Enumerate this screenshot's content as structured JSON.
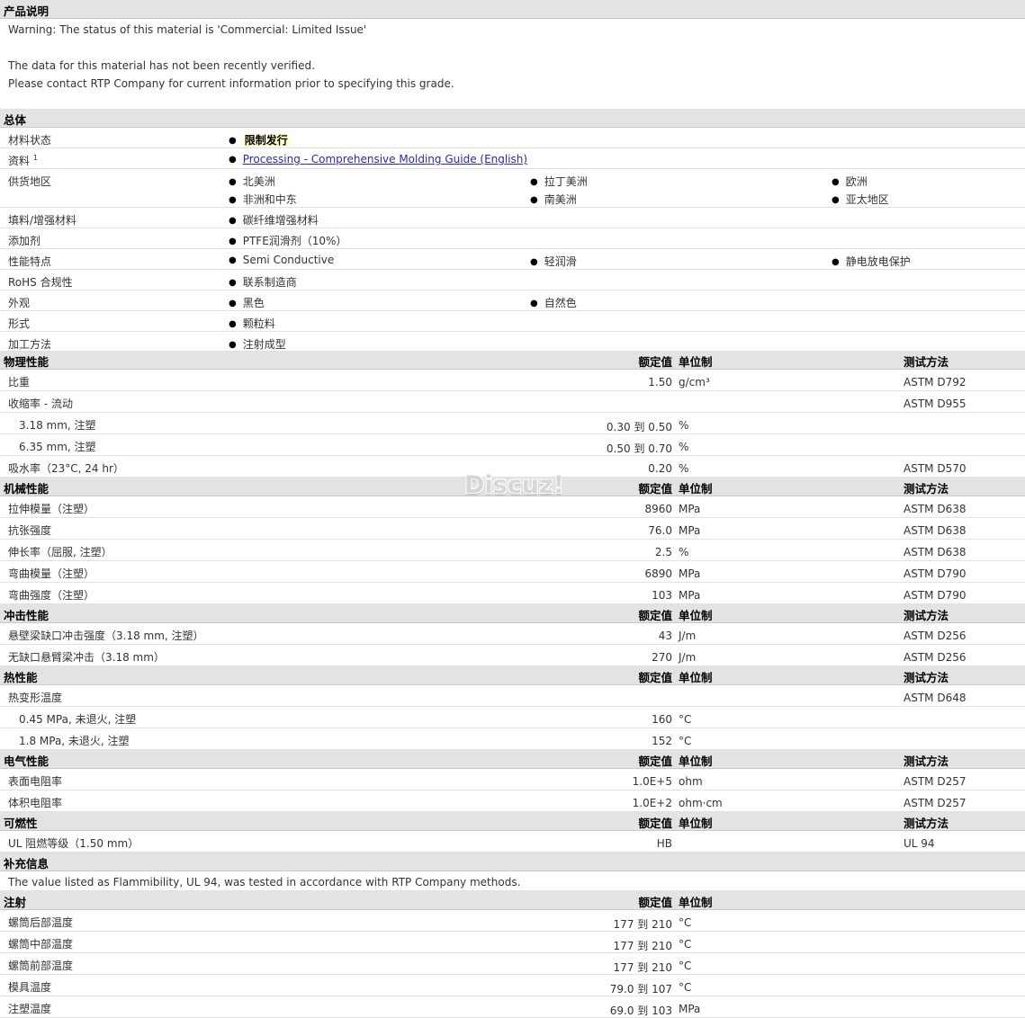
{
  "product_description": {
    "title": "产品说明",
    "lines": [
      "Warning: The status of this material is 'Commercial: Limited Issue'",
      "The data for this material has not been recently verified.",
      "Please contact RTP Company for current information prior to specifying this grade."
    ]
  },
  "general": {
    "title": "总体",
    "material_status": {
      "label": "材料状态",
      "value": "限制发行"
    },
    "resources": {
      "label": "资料",
      "sup": "1",
      "link": "Processing - Comprehensive Molding Guide (English)"
    },
    "availability": {
      "label": "供货地区",
      "items": [
        "北美洲",
        "拉丁美洲",
        "欧洲",
        "非洲和中东",
        "南美洲",
        "亚太地区"
      ]
    },
    "filler": {
      "label": "填料/增强材料",
      "items": [
        "碳纤维增强材料"
      ]
    },
    "additive": {
      "label": "添加剂",
      "items": [
        "PTFE润滑剂（10%）"
      ]
    },
    "features": {
      "label": "性能特点",
      "items": [
        "Semi Conductive",
        "轻润滑",
        "静电放电保护"
      ]
    },
    "rohs": {
      "label": "RoHS 合规性",
      "items": [
        "联系制造商"
      ]
    },
    "appearance": {
      "label": "外观",
      "items": [
        "黑色",
        "自然色"
      ]
    },
    "form": {
      "label": "形式",
      "items": [
        "颗粒料"
      ]
    },
    "processing": {
      "label": "加工方法",
      "items": [
        "注射成型"
      ]
    }
  },
  "headers": {
    "nominal": "额定值",
    "unit": "单位制",
    "method": "测试方法"
  },
  "physical": {
    "title": "物理性能",
    "rows": [
      {
        "label": "比重",
        "value": "1.50",
        "unit": "g/cm³",
        "method": "ASTM D792"
      },
      {
        "label": "收缩率  - 流动",
        "value": "",
        "unit": "",
        "method": "ASTM D955"
      },
      {
        "label": "3.18 mm, 注塑",
        "value": "0.30 到  0.50",
        "unit": "%",
        "method": "",
        "sub": true
      },
      {
        "label": "6.35 mm, 注塑",
        "value": "0.50 到  0.70",
        "unit": "%",
        "method": "",
        "sub": true
      },
      {
        "label": "吸水率（23°C, 24 hr）",
        "value": "0.20",
        "unit": "%",
        "method": "ASTM D570"
      }
    ]
  },
  "mechanical": {
    "title": "机械性能",
    "rows": [
      {
        "label": "拉伸模量（注塑）",
        "value": "8960",
        "unit": "MPa",
        "method": "ASTM D638"
      },
      {
        "label": "抗张强度",
        "value": "76.0",
        "unit": "MPa",
        "method": "ASTM D638"
      },
      {
        "label": "伸长率（屈服, 注塑）",
        "value": "2.5",
        "unit": "%",
        "method": "ASTM D638"
      },
      {
        "label": "弯曲模量（注塑）",
        "value": "6890",
        "unit": "MPa",
        "method": "ASTM D790"
      },
      {
        "label": "弯曲强度（注塑）",
        "value": "103",
        "unit": "MPa",
        "method": "ASTM D790"
      }
    ]
  },
  "impact": {
    "title": "冲击性能",
    "rows": [
      {
        "label": "悬壁梁缺口冲击强度（3.18 mm, 注塑）",
        "value": "43",
        "unit": "J/m",
        "method": "ASTM D256"
      },
      {
        "label": "无缺口悬臂梁冲击（3.18 mm）",
        "value": "270",
        "unit": "J/m",
        "method": "ASTM D256"
      }
    ]
  },
  "thermal": {
    "title": "热性能",
    "rows": [
      {
        "label": "热变形温度",
        "value": "",
        "unit": "",
        "method": "ASTM D648"
      },
      {
        "label": "0.45 MPa, 未退火, 注塑",
        "value": "160",
        "unit": "°C",
        "method": "",
        "sub": true
      },
      {
        "label": "1.8 MPa, 未退火, 注塑",
        "value": "152",
        "unit": "°C",
        "method": "",
        "sub": true
      }
    ]
  },
  "electrical": {
    "title": "电气性能",
    "rows": [
      {
        "label": "表面电阻率",
        "value": "1.0E+5",
        "unit": "ohm",
        "method": "ASTM D257"
      },
      {
        "label": "体积电阻率",
        "value": "1.0E+2",
        "unit": "ohm·cm",
        "method": "ASTM D257"
      }
    ]
  },
  "flammability": {
    "title": "可燃性",
    "rows": [
      {
        "label": "UL 阻燃等级（1.50 mm）",
        "value": "HB",
        "unit": "",
        "method": "UL 94"
      }
    ]
  },
  "supplemental": {
    "title": "补充信息",
    "note": "The value listed as Flammibility, UL 94, was tested in accordance with RTP Company methods."
  },
  "injection": {
    "title": "注射",
    "rows": [
      {
        "label": "螺筒后部温度",
        "value": "177 到  210",
        "unit": "°C",
        "method": ""
      },
      {
        "label": "螺筒中部温度",
        "value": "177 到  210",
        "unit": "°C",
        "method": ""
      },
      {
        "label": "螺筒前部温度",
        "value": "177 到  210",
        "unit": "°C",
        "method": ""
      },
      {
        "label": "模具温度",
        "value": "79.0 到  107",
        "unit": "°C",
        "method": ""
      },
      {
        "label": "注塑温度",
        "value": "69.0 到  103",
        "unit": "MPa",
        "method": ""
      }
    ]
  },
  "watermark": "Discuz!"
}
